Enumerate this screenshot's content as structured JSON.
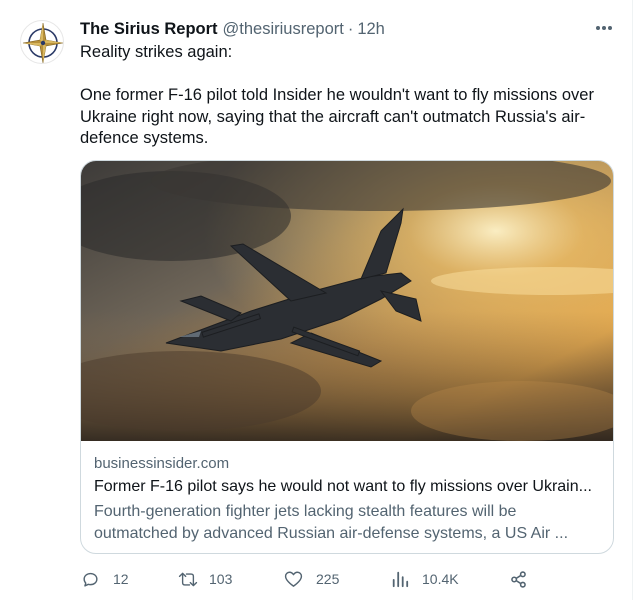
{
  "author": {
    "name": "The Sirius Report",
    "handle": "@thesiriusreport",
    "separator": "·",
    "time": "12h",
    "avatar_icon": "compass-star-logo"
  },
  "tweet": {
    "line1": "Reality strikes again:",
    "line2": "One former F-16 pilot told Insider he wouldn't want to fly missions over Ukraine right now, saying that the aircraft can't outmatch Russia's air-defence systems."
  },
  "card": {
    "image_icon": "f16-fighter-jet-image",
    "domain": "businessinsider.com",
    "title": "Former F-16 pilot says he would not want to fly missions over Ukrain...",
    "description": "Fourth-generation fighter jets lacking stealth features will be outmatched by advanced Russian air-defense systems, a US Air ..."
  },
  "actions": {
    "replies": "12",
    "retweets": "103",
    "likes": "225",
    "views": "10.4K"
  },
  "icons": {
    "more": "more-dots-icon",
    "reply": "reply-icon",
    "retweet": "retweet-icon",
    "like": "heart-icon",
    "views": "views-chart-icon",
    "share": "share-icon"
  },
  "colors": {
    "text": "#0f1419",
    "secondary": "#536471",
    "border": "#cfd9de",
    "logo_gold": "#b8913a",
    "logo_navy": "#2b3a67"
  }
}
